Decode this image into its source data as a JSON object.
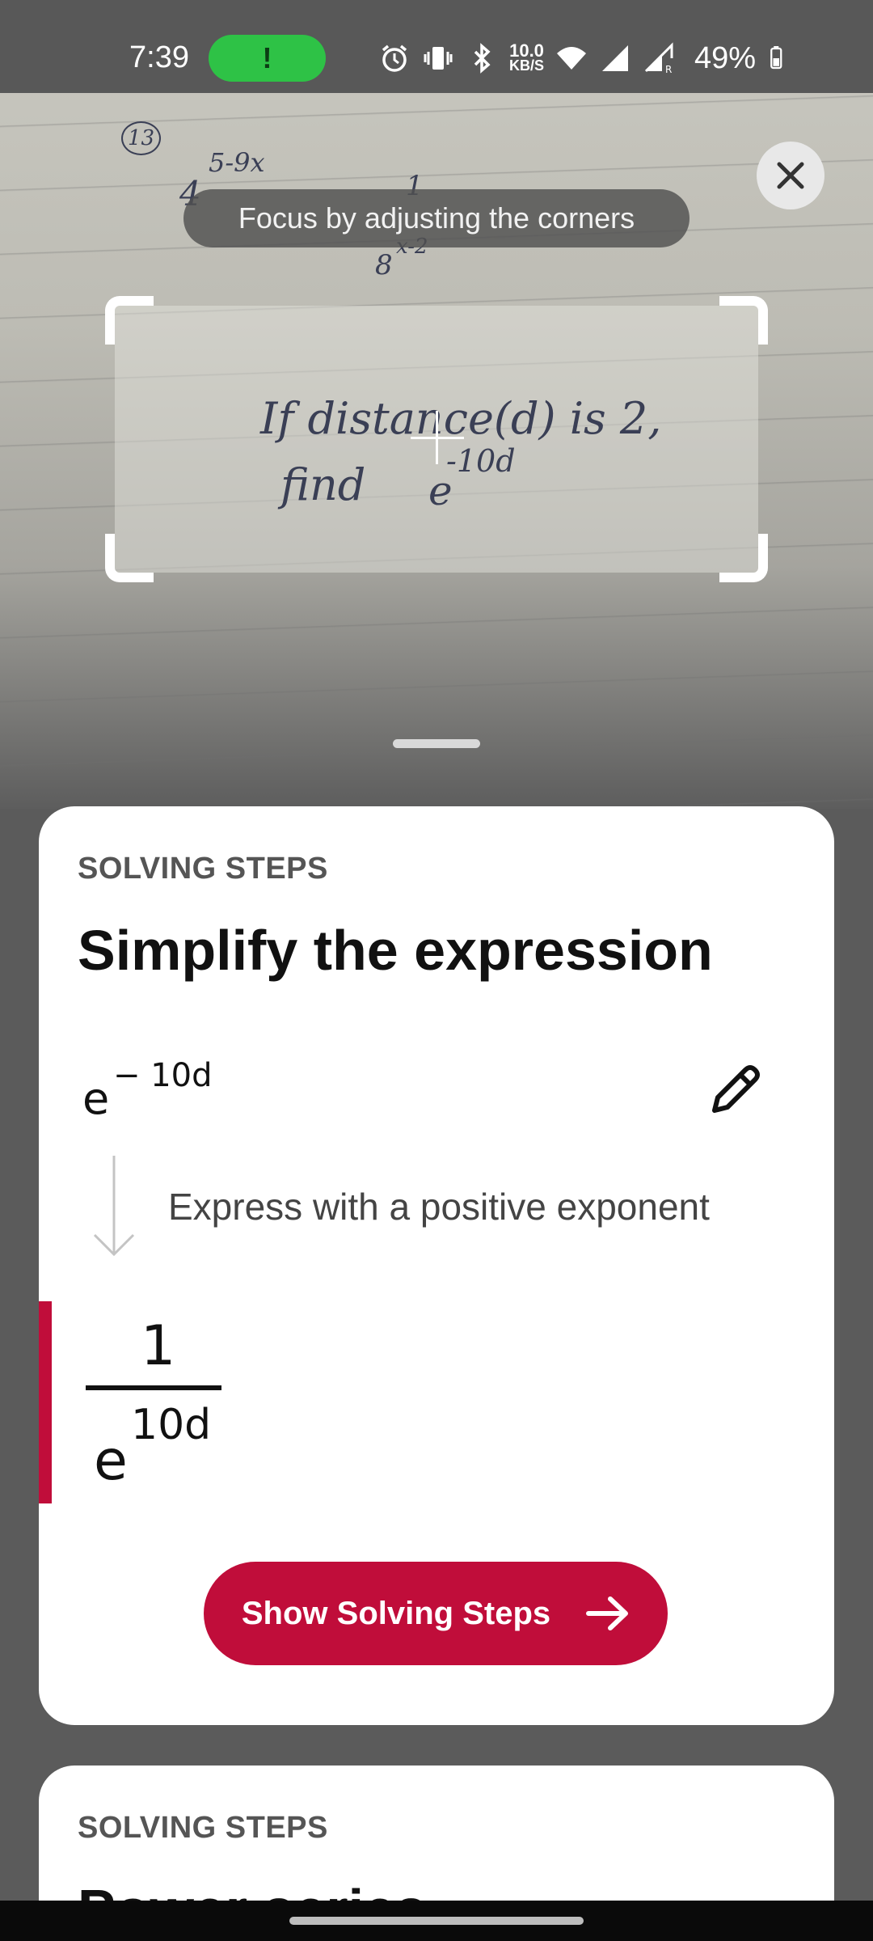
{
  "status_bar": {
    "time": "7:39",
    "call_indicator": "!",
    "net_speed_value": "10.0",
    "net_speed_unit": "KB/S",
    "battery": "49%",
    "icons": [
      "alarm-icon",
      "vibrate-icon",
      "bluetooth-icon",
      "wifi-icon",
      "signal-icon",
      "signal-roaming-icon",
      "battery-icon"
    ]
  },
  "camera": {
    "hint": "Focus by adjusting the corners",
    "close_icon": "close-icon",
    "handwriting": {
      "problem_number": "13",
      "background_expr_base": "4",
      "background_expr_exponent": "5-9x",
      "background_numerator": "1",
      "background_denominator_base": "8",
      "background_denominator_exponent": "x-2",
      "line1": "If distance(d) is 2,",
      "line2_word": "find",
      "line2_base": "e",
      "line2_exponent": "-10d"
    }
  },
  "card1": {
    "kicker": "SOLVING STEPS",
    "title": "Simplify the expression",
    "expression": {
      "base": "e",
      "exponent": "− 10d"
    },
    "edit_icon": "pencil-icon",
    "step_description": "Express with a positive exponent",
    "result": {
      "numerator": "1",
      "denominator_base": "e",
      "denominator_exponent": "10d"
    },
    "cta_label": "Show Solving Steps",
    "cta_icon": "arrow-right-icon",
    "accent_color": "#c00d3a"
  },
  "card2": {
    "kicker": "SOLVING STEPS",
    "title": "Power series"
  }
}
